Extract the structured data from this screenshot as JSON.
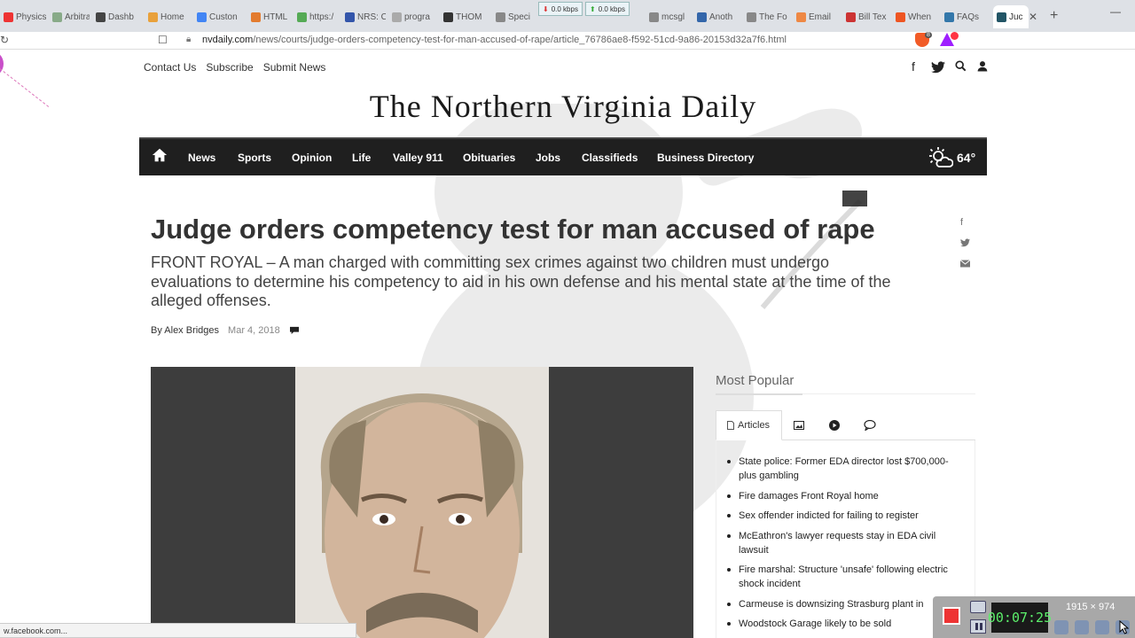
{
  "browser": {
    "tabs": [
      {
        "label": "Physics",
        "color": "#e33"
      },
      {
        "label": "Arbitra",
        "color": "#8a8"
      },
      {
        "label": "Dashb",
        "color": "#444"
      },
      {
        "label": "Home",
        "color": "#e9a13b"
      },
      {
        "label": "Custon",
        "color": "#4285f4"
      },
      {
        "label": "HTML",
        "color": "#e37b2e"
      },
      {
        "label": "https:/",
        "color": "#5a5"
      },
      {
        "label": "NRS: C",
        "color": "#35a"
      },
      {
        "label": "progra",
        "color": "#aaa"
      },
      {
        "label": "THOM",
        "color": "#333"
      },
      {
        "label": "Speci",
        "color": "#888"
      },
      {
        "label": "mcsgl",
        "color": "#888"
      },
      {
        "label": "Anoth",
        "color": "#3366aa"
      },
      {
        "label": "The Fo",
        "color": "#888"
      },
      {
        "label": "Email",
        "color": "#e84"
      },
      {
        "label": "Bill Tex",
        "color": "#c33"
      },
      {
        "label": "When",
        "color": "#e52"
      },
      {
        "label": "FAQs",
        "color": "#37a"
      },
      {
        "label": "Juc",
        "color": "#256"
      }
    ],
    "kbps_down": "0.0 kbps",
    "kbps_up": "0.0 kbps",
    "url_host": "nvdaily.com",
    "url_path": "/news/courts/judge-orders-competency-test-for-man-accused-of-rape/article_76786ae8-f592-51cd-9a86-20153d32a7f6.html",
    "status_url": "w.facebook.com..."
  },
  "site": {
    "top_links": [
      "Contact Us",
      "Subscribe",
      "Submit News"
    ],
    "masthead": "The Northern Virginia Daily",
    "nav": [
      "News",
      "Sports",
      "Opinion",
      "Life",
      "Valley 911",
      "Obituaries",
      "Jobs",
      "Classifieds",
      "Business Directory"
    ],
    "weather_temp": "64°"
  },
  "article": {
    "headline": "Judge orders competency test for man accused of rape",
    "summary": "FRONT ROYAL – A man charged with committing sex crimes against two children must undergo evaluations to determine his competency to aid in his own defense and his mental state at the time of the alleged offenses.",
    "author": "By Alex Bridges",
    "date": "Mar 4, 2018"
  },
  "most_popular": {
    "title": "Most Popular",
    "tabs": {
      "articles": "Articles"
    },
    "items": [
      "State police: Former EDA director lost $700,000-plus gambling",
      "Fire damages Front Royal home",
      "Sex offender indicted for failing to register",
      "McEathron's lawyer requests stay in EDA civil lawsuit",
      "Fire marshal: Structure 'unsafe' following electric shock incident",
      "Carmeuse is downsizing Strasburg plant in",
      "Woodstock Garage likely to be sold"
    ]
  },
  "recorder": {
    "time": "00:07:25",
    "size": "1915 × 974"
  },
  "colors": {
    "nav_bg": "#1f1f1f",
    "recorder_time": "#5cf06b",
    "record_button": "#ee3333"
  }
}
